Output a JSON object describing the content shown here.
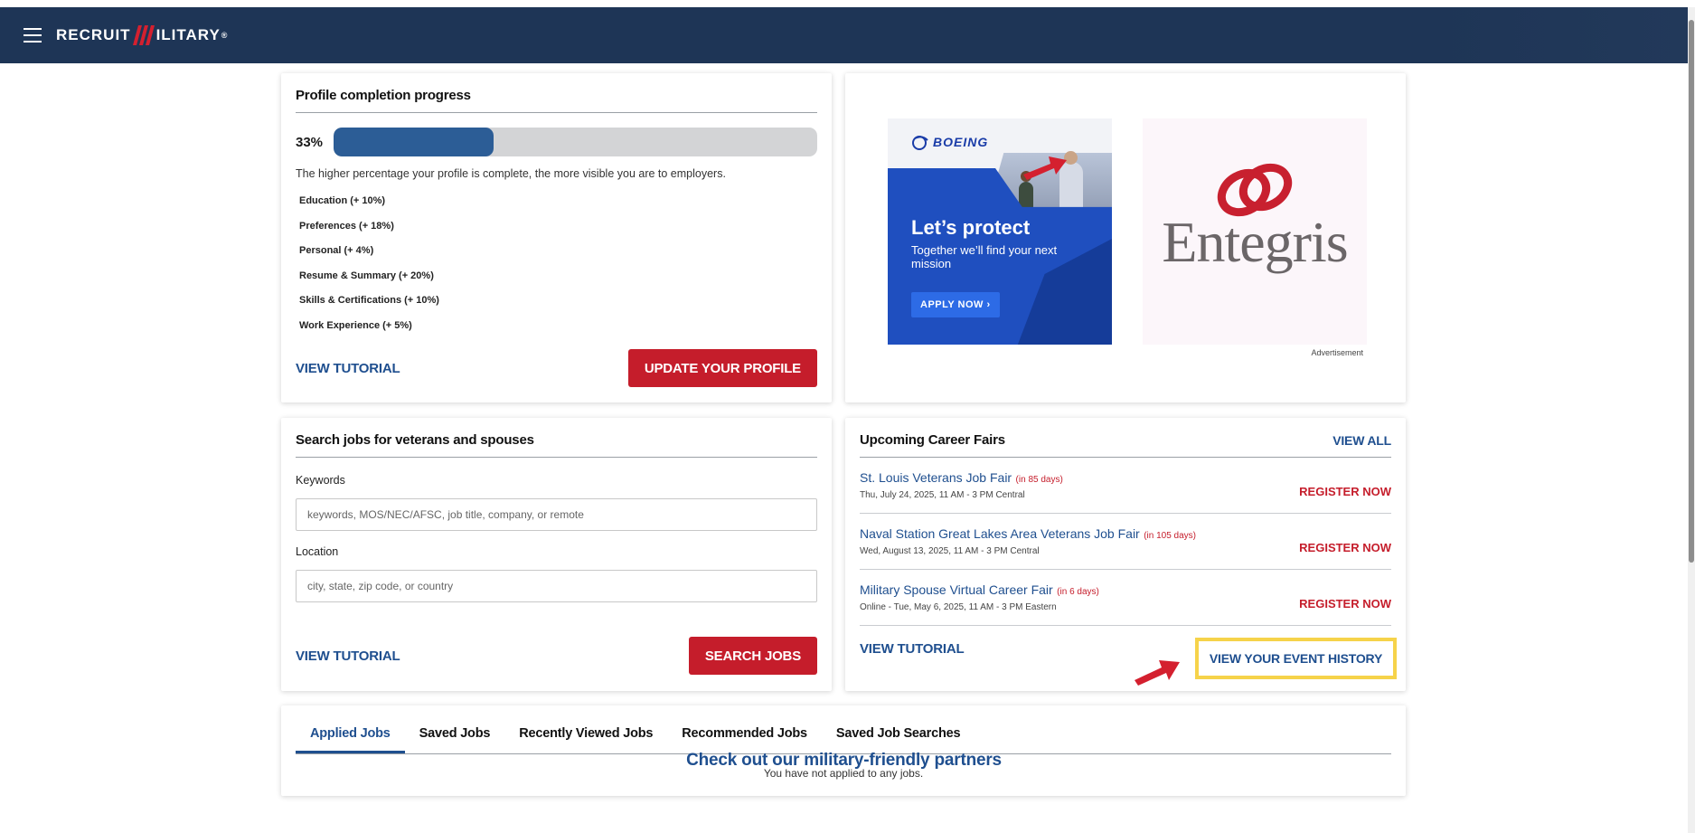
{
  "header": {
    "logo_left": "RECRUIT",
    "logo_right": "ILITARY",
    "logo_mark": "®"
  },
  "profile": {
    "title": "Profile completion progress",
    "percent_label": "33%",
    "percent_value": 33,
    "description": "The higher percentage your profile is complete, the more visible you are to employers.",
    "items": [
      "Education (+ 10%)",
      "Preferences (+ 18%)",
      "Personal (+ 4%)",
      "Resume & Summary (+ 20%)",
      "Skills & Certifications (+ 10%)",
      "Work Experience (+ 5%)"
    ],
    "tutorial_label": "VIEW TUTORIAL",
    "update_label": "UPDATE YOUR PROFILE"
  },
  "ad": {
    "boeing_brand": "BOEING",
    "boeing_headline": "Let’s protect",
    "boeing_sub": "Together we’ll find your next mission",
    "boeing_apply": "APPLY NOW ›",
    "entegris_word": "Entegris",
    "label": "Advertisement"
  },
  "search": {
    "title": "Search jobs for veterans and spouses",
    "keywords_label": "Keywords",
    "keywords_placeholder": "keywords, MOS/NEC/AFSC, job title, company, or remote",
    "location_label": "Location",
    "location_placeholder": "city, state, zip code, or country",
    "tutorial_label": "VIEW TUTORIAL",
    "search_label": "SEARCH JOBS"
  },
  "fairs": {
    "title": "Upcoming Career Fairs",
    "view_all": "VIEW ALL",
    "items": [
      {
        "name": "St. Louis Veterans Job Fair",
        "days": "(in 85 days)",
        "date": "Thu, July 24, 2025, 11 AM - 3 PM Central",
        "register": "REGISTER NOW"
      },
      {
        "name": "Naval Station Great Lakes Area Veterans Job Fair",
        "days": "(in 105 days)",
        "date": "Wed, August 13, 2025, 11 AM - 3 PM Central",
        "register": "REGISTER NOW"
      },
      {
        "name": "Military Spouse Virtual Career Fair",
        "days": "(in 6 days)",
        "date": "Online - Tue, May 6, 2025, 11 AM - 3 PM Eastern",
        "register": "REGISTER NOW"
      }
    ],
    "tutorial_label": "VIEW TUTORIAL",
    "history_label": "VIEW YOUR EVENT HISTORY"
  },
  "tabs": {
    "items": [
      "Applied Jobs",
      "Saved Jobs",
      "Recently Viewed Jobs",
      "Recommended Jobs",
      "Saved Job Searches"
    ],
    "active_index": 0,
    "empty_text": "You have not applied to any jobs."
  },
  "partners": {
    "heading": "Check out our military-friendly partners"
  },
  "colors": {
    "navy": "#1e3556",
    "link_blue": "#1f4f8f",
    "brand_red": "#c51d2b",
    "progress_fill": "#2c5d96",
    "highlight_yellow": "#f6d34a"
  },
  "icons": [
    "hamburger-menu-icon",
    "red-slash-logo-mark",
    "red-arrow-annotation-icon",
    "entegris-mark-icon",
    "boeing-mark-icon"
  ]
}
